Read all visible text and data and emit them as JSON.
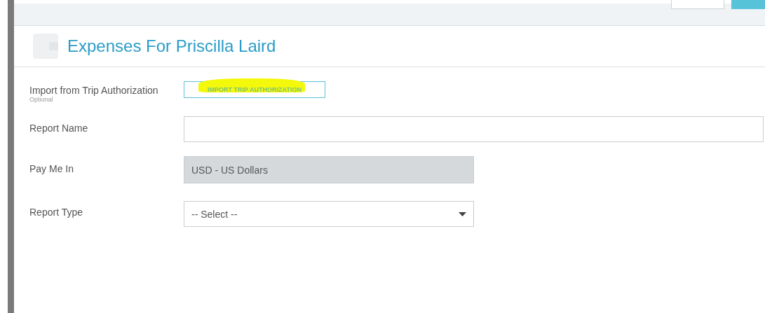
{
  "title": "Expenses For Priscilla Laird",
  "fields": [
    {
      "kind": "button",
      "label": "Import from Trip Authorization",
      "hint": "Optional",
      "value": "IMPORT TRIP AUTHORIZATION",
      "highlighted": true
    },
    {
      "kind": "text",
      "label": "Report Name",
      "disabled": false
    },
    {
      "kind": "text",
      "label": "Pay Me In",
      "value": "USD - US Dollars",
      "disabled": true
    },
    {
      "kind": "select",
      "label": "Report Type",
      "value": "-- Select --"
    }
  ]
}
